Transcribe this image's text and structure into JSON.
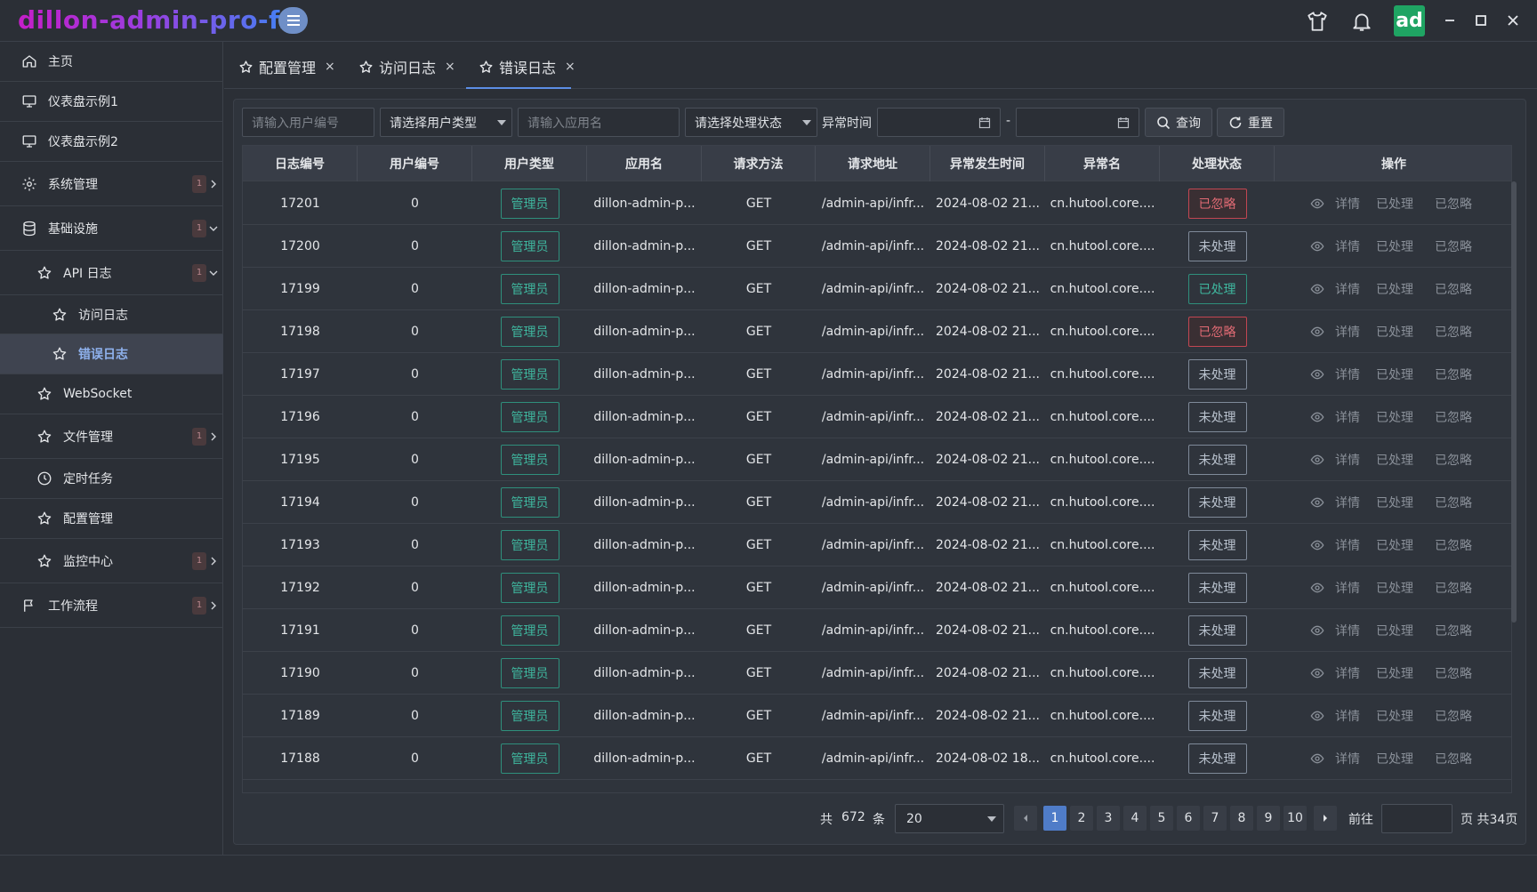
{
  "app": {
    "brand": "dillon-admin-pro-fx",
    "avatar": "ad"
  },
  "titlebar_icons": [
    "menu-icon",
    "shirt-icon",
    "bell-icon",
    "minimize-icon",
    "maximize-icon",
    "close-icon"
  ],
  "sidebar": {
    "items": [
      {
        "label": "主页",
        "icon": "home-icon"
      },
      {
        "label": "仪表盘示例1",
        "icon": "monitor-icon"
      },
      {
        "label": "仪表盘示例2",
        "icon": "monitor-icon"
      },
      {
        "label": "系统管理",
        "icon": "gear-icon",
        "badge": "1",
        "chevron": "right"
      },
      {
        "label": "基础设施",
        "icon": "database-icon",
        "badge": "1",
        "chevron": "down"
      },
      {
        "label": "API 日志",
        "icon": "star-icon",
        "badge": "1",
        "chevron": "down"
      },
      {
        "label": "访问日志",
        "icon": "star-icon"
      },
      {
        "label": "错误日志",
        "icon": "star-icon",
        "active": true
      },
      {
        "label": "WebSocket",
        "icon": "star-icon"
      },
      {
        "label": "文件管理",
        "icon": "star-icon",
        "badge": "1",
        "chevron": "right"
      },
      {
        "label": "定时任务",
        "icon": "clock-icon"
      },
      {
        "label": "配置管理",
        "icon": "star-icon"
      },
      {
        "label": "监控中心",
        "icon": "star-icon",
        "badge": "1",
        "chevron": "right"
      },
      {
        "label": "工作流程",
        "icon": "flag-icon",
        "badge": "1",
        "chevron": "right"
      }
    ]
  },
  "tabs": [
    {
      "label": "配置管理",
      "close": "×"
    },
    {
      "label": "访问日志",
      "close": "×"
    },
    {
      "label": "错误日志",
      "close": "×",
      "active": true
    }
  ],
  "filters": {
    "user_id_placeholder": "请输入用户编号",
    "user_type": "请选择用户类型",
    "app_name_placeholder": "请输入应用名",
    "process_status": "请选择处理状态",
    "time_label": "异常时间",
    "date_separator": "-",
    "search_label": "查询",
    "reset_label": "重置"
  },
  "table": {
    "columns": [
      "日志编号",
      "用户编号",
      "用户类型",
      "应用名",
      "请求方法",
      "请求地址",
      "异常发生时间",
      "异常名",
      "处理状态",
      "操作"
    ],
    "actions": {
      "detail": "详情",
      "handled": "已处理",
      "ignored": "已忽略"
    },
    "rows": [
      {
        "id": "17201",
        "user_id": "0",
        "user_type": "管理员",
        "app": "dillon-admin-p...",
        "method": "GET",
        "url": "/admin-api/infr...",
        "time": "2024-08-02 21...",
        "exception": "cn.hutool.core....",
        "status": "已忽略",
        "status_kind": "ignored"
      },
      {
        "id": "17200",
        "user_id": "0",
        "user_type": "管理员",
        "app": "dillon-admin-p...",
        "method": "GET",
        "url": "/admin-api/infr...",
        "time": "2024-08-02 21...",
        "exception": "cn.hutool.core....",
        "status": "未处理",
        "status_kind": "pending"
      },
      {
        "id": "17199",
        "user_id": "0",
        "user_type": "管理员",
        "app": "dillon-admin-p...",
        "method": "GET",
        "url": "/admin-api/infr...",
        "time": "2024-08-02 21...",
        "exception": "cn.hutool.core....",
        "status": "已处理",
        "status_kind": "handled"
      },
      {
        "id": "17198",
        "user_id": "0",
        "user_type": "管理员",
        "app": "dillon-admin-p...",
        "method": "GET",
        "url": "/admin-api/infr...",
        "time": "2024-08-02 21...",
        "exception": "cn.hutool.core....",
        "status": "已忽略",
        "status_kind": "ignored"
      },
      {
        "id": "17197",
        "user_id": "0",
        "user_type": "管理员",
        "app": "dillon-admin-p...",
        "method": "GET",
        "url": "/admin-api/infr...",
        "time": "2024-08-02 21...",
        "exception": "cn.hutool.core....",
        "status": "未处理",
        "status_kind": "pending"
      },
      {
        "id": "17196",
        "user_id": "0",
        "user_type": "管理员",
        "app": "dillon-admin-p...",
        "method": "GET",
        "url": "/admin-api/infr...",
        "time": "2024-08-02 21...",
        "exception": "cn.hutool.core....",
        "status": "未处理",
        "status_kind": "pending"
      },
      {
        "id": "17195",
        "user_id": "0",
        "user_type": "管理员",
        "app": "dillon-admin-p...",
        "method": "GET",
        "url": "/admin-api/infr...",
        "time": "2024-08-02 21...",
        "exception": "cn.hutool.core....",
        "status": "未处理",
        "status_kind": "pending"
      },
      {
        "id": "17194",
        "user_id": "0",
        "user_type": "管理员",
        "app": "dillon-admin-p...",
        "method": "GET",
        "url": "/admin-api/infr...",
        "time": "2024-08-02 21...",
        "exception": "cn.hutool.core....",
        "status": "未处理",
        "status_kind": "pending"
      },
      {
        "id": "17193",
        "user_id": "0",
        "user_type": "管理员",
        "app": "dillon-admin-p...",
        "method": "GET",
        "url": "/admin-api/infr...",
        "time": "2024-08-02 21...",
        "exception": "cn.hutool.core....",
        "status": "未处理",
        "status_kind": "pending"
      },
      {
        "id": "17192",
        "user_id": "0",
        "user_type": "管理员",
        "app": "dillon-admin-p...",
        "method": "GET",
        "url": "/admin-api/infr...",
        "time": "2024-08-02 21...",
        "exception": "cn.hutool.core....",
        "status": "未处理",
        "status_kind": "pending"
      },
      {
        "id": "17191",
        "user_id": "0",
        "user_type": "管理员",
        "app": "dillon-admin-p...",
        "method": "GET",
        "url": "/admin-api/infr...",
        "time": "2024-08-02 21...",
        "exception": "cn.hutool.core....",
        "status": "未处理",
        "status_kind": "pending"
      },
      {
        "id": "17190",
        "user_id": "0",
        "user_type": "管理员",
        "app": "dillon-admin-p...",
        "method": "GET",
        "url": "/admin-api/infr...",
        "time": "2024-08-02 21...",
        "exception": "cn.hutool.core....",
        "status": "未处理",
        "status_kind": "pending"
      },
      {
        "id": "17189",
        "user_id": "0",
        "user_type": "管理员",
        "app": "dillon-admin-p...",
        "method": "GET",
        "url": "/admin-api/infr...",
        "time": "2024-08-02 21...",
        "exception": "cn.hutool.core....",
        "status": "未处理",
        "status_kind": "pending"
      },
      {
        "id": "17188",
        "user_id": "0",
        "user_type": "管理员",
        "app": "dillon-admin-p...",
        "method": "GET",
        "url": "/admin-api/infr...",
        "time": "2024-08-02 18...",
        "exception": "cn.hutool.core....",
        "status": "未处理",
        "status_kind": "pending"
      }
    ]
  },
  "pagination": {
    "total_prefix": "共",
    "total": "672",
    "total_suffix": "条",
    "page_size": "20",
    "pages": [
      "1",
      "2",
      "3",
      "4",
      "5",
      "6",
      "7",
      "8",
      "9",
      "10"
    ],
    "current_page": "1",
    "goto_label": "前往",
    "pages_suffix": "页 共34页"
  },
  "colors": {
    "accent": "#4f7cc8",
    "success": "#3fb79f",
    "danger": "#e26b74",
    "avatar_bg": "#1fa463"
  }
}
